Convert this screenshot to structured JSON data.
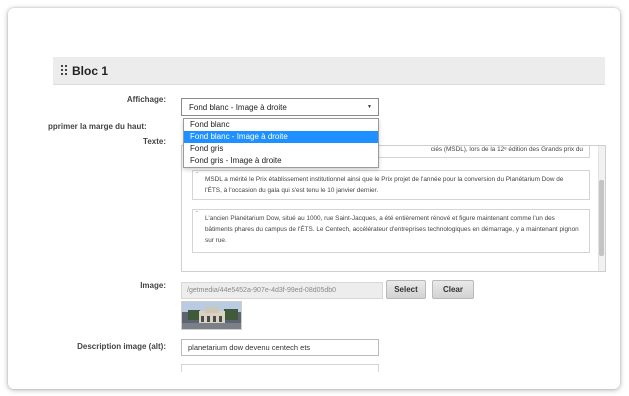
{
  "bloc": {
    "title": "Bloc 1"
  },
  "labels": {
    "affichage": "Affichage:",
    "marge": "pprimer la marge du haut:",
    "texte": "Texte:",
    "image": "Image:",
    "description": "Description image (alt):"
  },
  "affichage": {
    "selected": "Fond blanc - Image à droite",
    "options": [
      {
        "label": "Fond blanc",
        "selected": false
      },
      {
        "label": "Fond blanc - Image à droite",
        "selected": true
      },
      {
        "label": "Fond gris",
        "selected": false
      },
      {
        "label": "Fond gris - Image à droite",
        "selected": false
      }
    ]
  },
  "texte": {
    "partial_line": "ciés (MSDL), lors de la 12ᵉ édition des Grands prix du",
    "paragraphs": [
      "MSDL a mérité le Prix établissement institutionnel ainsi que le Prix projet de l'année pour la conversion du Planétarium Dow de l'ÉTS, à l'occasion du gala qui s'est tenu le 10 janvier dernier.",
      "L'ancien Planétarium Dow, situé au 1000, rue Saint-Jacques, a été entièrement rénové et figure maintenant comme l'un des bâtiments phares du campus de l'ÉTS. Le Centech, accélérateur d'entreprises technologiques en démarrage, y a maintenant pignon sur rue."
    ]
  },
  "image": {
    "path": "/getmedia/44e5452a-907e-4d3f-99ed-08d05db0",
    "select_label": "Select",
    "clear_label": "Clear"
  },
  "description": {
    "value": "planetarium dow devenu centech ets"
  },
  "colors": {
    "selected_option": "#1e90ff",
    "header_bg": "#ececec"
  }
}
